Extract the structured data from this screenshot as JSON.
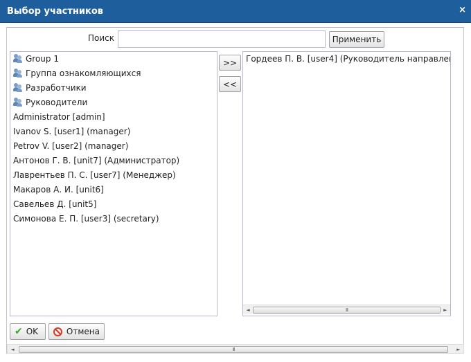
{
  "dialog": {
    "title": "Выбор участников",
    "close_glyph": "×"
  },
  "search": {
    "label": "Поиск",
    "value": "",
    "placeholder": "",
    "apply_label": "Применить"
  },
  "available": {
    "groups": [
      {
        "label": "Group 1",
        "icon": "group-icon"
      },
      {
        "label": "Группа ознакомляющихся",
        "icon": "group-icon"
      },
      {
        "label": "Разработчики",
        "icon": "group-icon"
      },
      {
        "label": "Руководители",
        "icon": "group-icon"
      }
    ],
    "users": [
      "Administrator [admin]",
      "Ivanov S. [user1] (manager)",
      "Petrov V. [user2] (manager)",
      "Антонов Г. В. [unit7] (Администратор)",
      "Лаврентьев П. С. [user7] (Менеджер)",
      "Макаров А. И. [unit6]",
      "Савельев Д. [unit5]",
      "Симонова Е. П. [user3] (secretary)"
    ]
  },
  "selected": {
    "users": [
      "Гордеев П. В. [user4] (Руководитель направлен"
    ]
  },
  "buttons": {
    "add_label": ">>",
    "remove_label": "<<",
    "ok_label": "OK",
    "cancel_label": "Отмена"
  },
  "scrollbars": {
    "thumb_grip": "III",
    "left_arrow": "◄",
    "right_arrow": "►"
  }
}
